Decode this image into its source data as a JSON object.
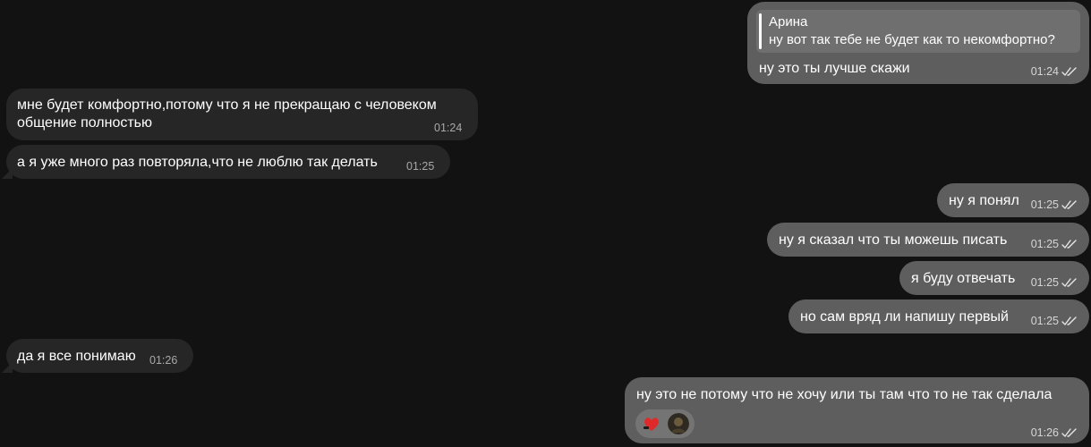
{
  "messages": [
    {
      "dir": "out",
      "reply_author": "Арина",
      "reply_text": "ну вот так тебе не будет как то некомфортно?",
      "text": "ну это ты лучше скажи",
      "time": "01:24"
    },
    {
      "dir": "in",
      "text_lines": [
        "мне будет комфортно,потому что я не прекращаю с человеком",
        "общение полностью"
      ],
      "time": "01:24"
    },
    {
      "dir": "in",
      "text": "а я уже много раз повторяла,что не люблю так делать",
      "time": "01:25"
    },
    {
      "dir": "out",
      "text": "ну я понял",
      "time": "01:25"
    },
    {
      "dir": "out",
      "text": "ну я сказал что ты можешь писать",
      "time": "01:25"
    },
    {
      "dir": "out",
      "text": "я буду отвечать",
      "time": "01:25"
    },
    {
      "dir": "out",
      "text": "но сам вряд ли напишу первый",
      "time": "01:25"
    },
    {
      "dir": "in",
      "text": "да я все понимаю",
      "time": "01:26"
    },
    {
      "dir": "out",
      "text": "ну это не потому что не хочу или ты там что то не так сделала",
      "time": "01:26",
      "reactions": [
        "heart-reaction-icon",
        "avatar-reaction-icon"
      ]
    }
  ],
  "colors": {
    "background": "#121212",
    "incoming": "#262626",
    "outgoing": "#5e5e5e"
  }
}
